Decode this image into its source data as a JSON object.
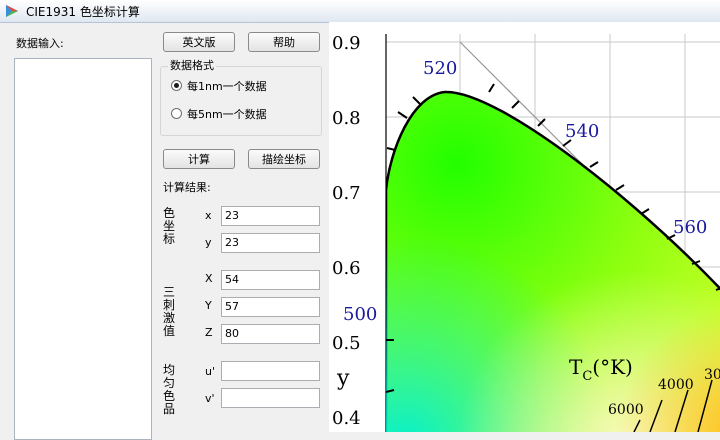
{
  "window": {
    "title": "CIE1931 色坐标计算",
    "icon": "app-icon"
  },
  "left": {
    "data_input_label": "数据输入:"
  },
  "buttons": {
    "english": "英文版",
    "help": "帮助",
    "calculate": "计算",
    "plot": "描绘坐标"
  },
  "format": {
    "title": "数据格式",
    "options": [
      {
        "label": "每1nm一个数据",
        "selected": true
      },
      {
        "label": "每5nm一个数据",
        "selected": false
      }
    ]
  },
  "results": {
    "title": "计算结果:",
    "chroma_label": "色坐标",
    "tristim_label": "三刺激值",
    "ucs_label": "均匀色品",
    "x_label": "x",
    "x_value": "23",
    "y_label": "y",
    "y_value": "23",
    "X_label": "X",
    "X_value": "54",
    "Y_label": "Y",
    "Y_value": "57",
    "Z_label": "Z",
    "Z_value": "80",
    "u_label": "u'",
    "u_value": "",
    "v_label": "v'",
    "v_value": ""
  },
  "chart_data": {
    "type": "diagram",
    "ylabel": "y",
    "y_ticks": [
      "0.9",
      "0.8",
      "0.7",
      "0.6",
      "0.5",
      "0.4"
    ],
    "wavelength_labels": [
      "520",
      "540",
      "560",
      "500"
    ],
    "cct_label_main": "T",
    "cct_label_sub": "C",
    "cct_label_unit": "(°K)",
    "cct_ticks": [
      "4000",
      "30",
      "6000"
    ],
    "grid": true
  }
}
